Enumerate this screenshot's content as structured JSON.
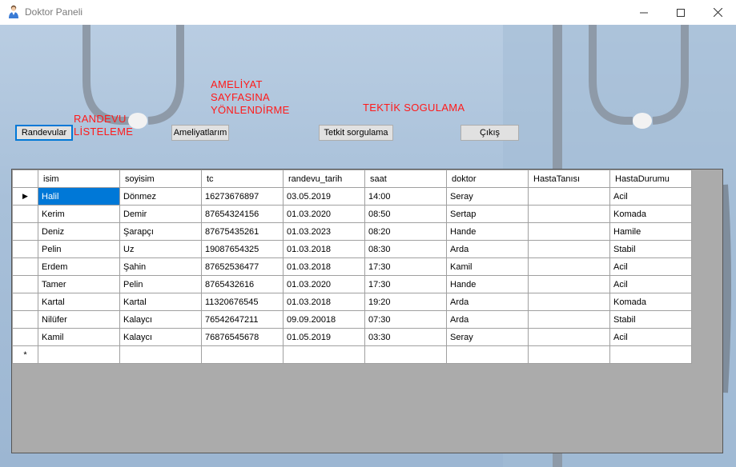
{
  "window": {
    "title": "Doktor Paneli",
    "minimize_icon": "minimize-icon",
    "maximize_icon": "maximize-icon",
    "close_icon": "close-icon"
  },
  "labels": {
    "randevu": [
      "RANDEVU",
      "LİSTELEME"
    ],
    "ameliyat": [
      "AMELİYAT",
      "SAYFASINA",
      "YÖNLENDİRME"
    ],
    "tetkik": "TEKTİK SOGULAMA"
  },
  "buttons": {
    "randevular": "Randevular",
    "ameliyatlar": "Ameliyatlarım",
    "tetkit": "Tetkit sorgulama",
    "cikis": "Çıkış"
  },
  "grid": {
    "columns": [
      "isim",
      "soyisim",
      "tc",
      "randevu_tarih",
      "saat",
      "doktor",
      "HastaTanısı",
      "HastaDurumu"
    ],
    "rows": [
      [
        "Halil",
        "Dönmez",
        "16273676897",
        "03.05.2019",
        "14:00",
        "Seray",
        "",
        "Acil"
      ],
      [
        "Kerim",
        "Demir",
        "87654324156",
        "01.03.2020",
        "08:50",
        "Sertap",
        "",
        "Komada"
      ],
      [
        "Deniz",
        "Şarapçı",
        "87675435261",
        "01.03.2023",
        "08:20",
        "Hande",
        "",
        "Hamile"
      ],
      [
        "Pelin",
        "Uz",
        "19087654325",
        "01.03.2018",
        "08:30",
        "Arda",
        "",
        "Stabil"
      ],
      [
        "Erdem",
        "Şahin",
        "87652536477",
        "01.03.2018",
        "17:30",
        "Kamil",
        "",
        "Acil"
      ],
      [
        "Tamer",
        "Pelin",
        "8765432616",
        "01.03.2020",
        "17:30",
        "Hande",
        "",
        "Acil"
      ],
      [
        "Kartal",
        "Kartal",
        "11320676545",
        "01.03.2018",
        "19:20",
        "Arda",
        "",
        "Komada"
      ],
      [
        "Nilüfer",
        "Kalaycı",
        "76542647211",
        "09.09.20018",
        "07:30",
        "Arda",
        "",
        "Stabil"
      ],
      [
        "Kamil",
        "Kalaycı",
        "76876545678",
        "01.05.2019",
        "03:30",
        "Seray",
        "",
        "Acil"
      ]
    ],
    "current_row_marker": "▶",
    "new_row_marker": "*"
  },
  "colors": {
    "label_red": "#ff1a1a",
    "selection_blue": "#0078d7",
    "grid_background": "#ababab"
  }
}
